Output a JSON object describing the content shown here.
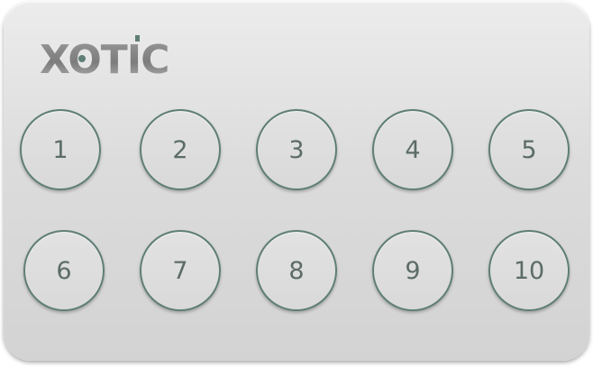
{
  "brand": {
    "logo_text": "XOTIC"
  },
  "pads": [
    {
      "label": "1"
    },
    {
      "label": "2"
    },
    {
      "label": "3"
    },
    {
      "label": "4"
    },
    {
      "label": "5"
    },
    {
      "label": "6"
    },
    {
      "label": "7"
    },
    {
      "label": "8"
    },
    {
      "label": "9"
    },
    {
      "label": "10"
    }
  ],
  "colors": {
    "panel": "#dcdcdc",
    "pad_border": "#5f7e76",
    "pad_text": "#5c6c68",
    "logo": "#8a8a8a"
  }
}
